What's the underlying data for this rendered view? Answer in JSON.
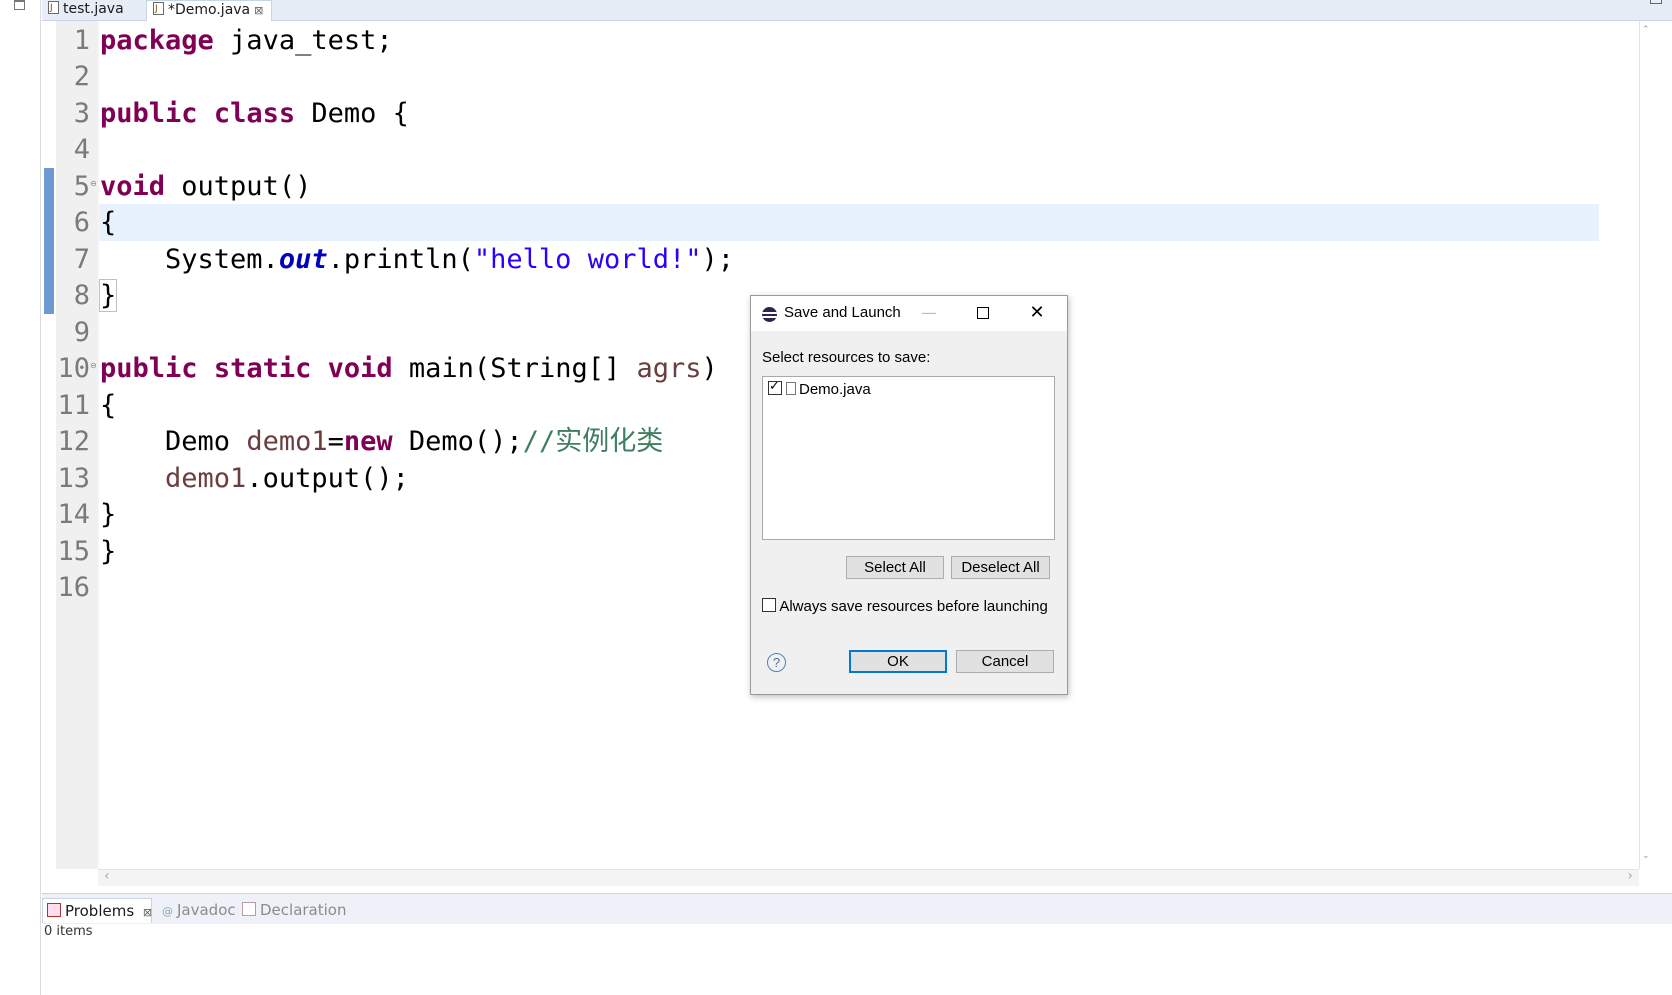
{
  "editor": {
    "tabs": [
      {
        "label": "test.java",
        "active": false
      },
      {
        "label": "*Demo.java",
        "active": true,
        "close": "⊠"
      }
    ],
    "lines": [
      {
        "num": "1"
      },
      {
        "num": "2"
      },
      {
        "num": "3"
      },
      {
        "num": "4"
      },
      {
        "num": "5"
      },
      {
        "num": "6"
      },
      {
        "num": "7"
      },
      {
        "num": "8"
      },
      {
        "num": "9"
      },
      {
        "num": "10"
      },
      {
        "num": "11"
      },
      {
        "num": "12"
      },
      {
        "num": "13"
      },
      {
        "num": "14"
      },
      {
        "num": "15"
      },
      {
        "num": "16"
      }
    ],
    "code": {
      "l1_kw": "package",
      "l1_rest": " java_test;",
      "l3_kw1": "public",
      "l3_kw2": "class",
      "l3_rest": " Demo {",
      "l5_kw": "void",
      "l5_rest": " output()",
      "l6": "{",
      "l7_a": "    System.",
      "l7_field": "out",
      "l7_b": ".println(",
      "l7_str": "\"hello world!\"",
      "l7_c": ");",
      "l8": "}",
      "l10_kw1": "public",
      "l10_kw2": "static",
      "l10_kw3": "void",
      "l10_a": " main(String[] ",
      "l10_var": "agrs",
      "l10_b": ")",
      "l11": "{",
      "l12_a": "    Demo ",
      "l12_var": "demo1",
      "l12_b": "=",
      "l12_kw": "new",
      "l12_c": " Demo();",
      "l12_cmt": "//实例化类",
      "l13_a": "    ",
      "l13_var": "demo1",
      "l13_b": ".output();",
      "l14": "}",
      "l15": "}"
    }
  },
  "views": {
    "tabs": [
      {
        "label": "Problems",
        "close": "⊠",
        "active": true
      },
      {
        "label": "Javadoc",
        "active": false
      },
      {
        "label": "Declaration",
        "active": false
      }
    ],
    "status": "0 items"
  },
  "dialog": {
    "title": "Save and Launch",
    "minimize": "—",
    "close": "✕",
    "prompt": "Select resources to save:",
    "resources": [
      {
        "label": "Demo.java",
        "checked": true
      }
    ],
    "select_all": "Select All",
    "deselect_all": "Deselect All",
    "always_save": "Always save resources before launching",
    "ok": "OK",
    "cancel": "Cancel",
    "help": "?"
  },
  "colors": {
    "keyword": "#7f0055",
    "string": "#2a00ff",
    "field": "#0000c0",
    "comment": "#3f7f5f",
    "local_var": "#6a3e3e",
    "current_line": "#e8f2fe",
    "change_ruler": "#6d9bd1"
  }
}
